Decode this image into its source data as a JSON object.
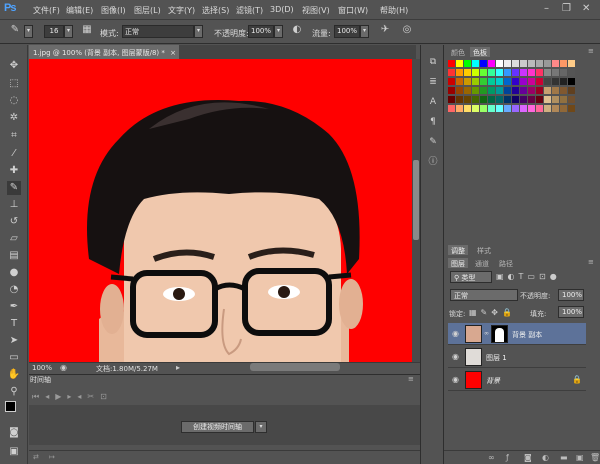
{
  "app": {
    "logo": "Ps"
  },
  "menu": [
    "文件(F)",
    "编辑(E)",
    "图像(I)",
    "图层(L)",
    "文字(Y)",
    "选择(S)",
    "滤镜(T)",
    "3D(D)",
    "视图(V)",
    "窗口(W)",
    "帮助(H)"
  ],
  "window_buttons": {
    "minimize": "–",
    "restore": "❐",
    "close": "✕"
  },
  "options": {
    "brush_size": "16",
    "mode_label": "模式:",
    "mode_value": "正常",
    "opacity_label": "不透明度:",
    "opacity_value": "100%",
    "flow_label": "流量:",
    "flow_value": "100%"
  },
  "document": {
    "tab_title": "1.jpg @ 100% (背景 副本, 图层蒙版/8) *",
    "tab_close": "×",
    "zoom": "100%",
    "doc_info": "文档:1.80M/5.27M"
  },
  "timeline": {
    "tab": "时间轴",
    "create_button": "创建视频时间轴"
  },
  "panels": {
    "color_tab": "颜色",
    "swatches_tab": "色板",
    "adjust_tab": "调整",
    "style_tab": "样式",
    "layers_tab": "图层",
    "channels_tab": "通道",
    "paths_tab": "路径"
  },
  "layers_panel": {
    "filter_kind": "类型",
    "blend_mode": "正常",
    "opacity_label": "不透明度:",
    "opacity_value": "100%",
    "lock_label": "锁定:",
    "fill_label": "填充:",
    "fill_value": "100%",
    "layers": [
      {
        "name": "背景 副本",
        "selected": true
      },
      {
        "name": "图层 1",
        "selected": false
      },
      {
        "name": "背景",
        "selected": false
      }
    ]
  },
  "colors": {
    "canvas_red": "#ff0000",
    "selected_layer": "#5d7299",
    "accent_blue": "#4fa3ff"
  }
}
